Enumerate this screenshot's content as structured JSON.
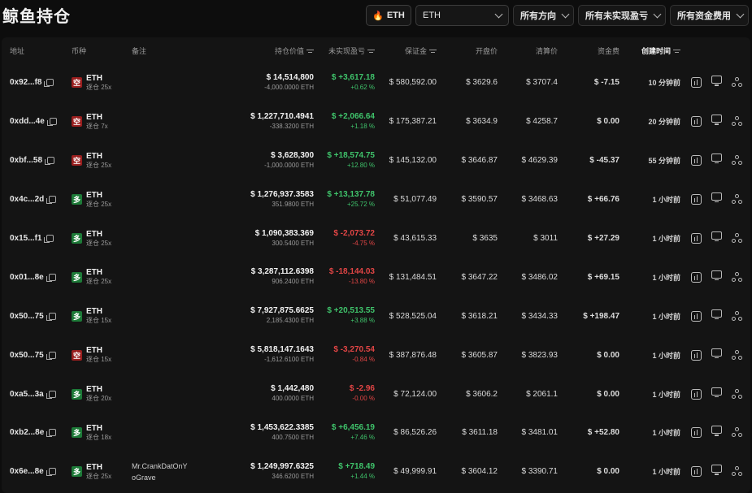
{
  "title": "鲸鱼持仓",
  "filters": {
    "coin_tag": "ETH",
    "coin_select": "ETH",
    "direction": "所有方向",
    "unrealized": "所有未实现盈亏",
    "funding": "所有资金费用"
  },
  "columns": {
    "address": "地址",
    "coin": "币种",
    "note": "备注",
    "value": "持仓价值",
    "pnl": "未实现盈亏",
    "margin": "保证金",
    "open_price": "开盘价",
    "liq_price": "清算价",
    "funding": "资金费",
    "created": "创建时间"
  },
  "rows": [
    {
      "address": "0x92...f8",
      "side": "空",
      "side_type": "short",
      "coin": "ETH",
      "leverage": "逐仓 25x",
      "note1": "",
      "note2": "",
      "value": "$ 14,514,800",
      "size": "-4,000.0000 ETH",
      "pnl": "$ +3,617.18",
      "pnl_pct": "+0.62 %",
      "pnl_type": "pos",
      "margin": "$ 580,592.00",
      "open": "$ 3629.6",
      "liq": "$ 3707.4",
      "funding": "$ -7.15",
      "funding_type": "neg",
      "time": "10 分钟前"
    },
    {
      "address": "0xdd...4e",
      "side": "空",
      "side_type": "short",
      "coin": "ETH",
      "leverage": "逐仓 7x",
      "note1": "",
      "note2": "",
      "value": "$ 1,227,710.4941",
      "size": "-338.3200 ETH",
      "pnl": "$ +2,066.64",
      "pnl_pct": "+1.18 %",
      "pnl_type": "pos",
      "margin": "$ 175,387.21",
      "open": "$ 3634.9",
      "liq": "$ 4258.7",
      "funding": "$ 0.00",
      "funding_type": "plain",
      "time": "20 分钟前"
    },
    {
      "address": "0xbf...58",
      "side": "空",
      "side_type": "short",
      "coin": "ETH",
      "leverage": "逐仓 25x",
      "note1": "",
      "note2": "",
      "value": "$ 3,628,300",
      "size": "-1,000.0000 ETH",
      "pnl": "$ +18,574.75",
      "pnl_pct": "+12.80 %",
      "pnl_type": "pos",
      "margin": "$ 145,132.00",
      "open": "$ 3646.87",
      "liq": "$ 4629.39",
      "funding": "$ -45.37",
      "funding_type": "neg",
      "time": "55 分钟前"
    },
    {
      "address": "0x4c...2d",
      "side": "多",
      "side_type": "long",
      "coin": "ETH",
      "leverage": "逐仓 25x",
      "note1": "",
      "note2": "",
      "value": "$ 1,276,937.3583",
      "size": "351.9800 ETH",
      "pnl": "$ +13,137.78",
      "pnl_pct": "+25.72 %",
      "pnl_type": "pos",
      "margin": "$ 51,077.49",
      "open": "$ 3590.57",
      "liq": "$ 3468.63",
      "funding": "$ +66.76",
      "funding_type": "pos",
      "time": "1 小时前"
    },
    {
      "address": "0x15...f1",
      "side": "多",
      "side_type": "long",
      "coin": "ETH",
      "leverage": "逐仓 25x",
      "note1": "",
      "note2": "",
      "value": "$ 1,090,383.369",
      "size": "300.5400 ETH",
      "pnl": "$ -2,073.72",
      "pnl_pct": "-4.75 %",
      "pnl_type": "neg",
      "margin": "$ 43,615.33",
      "open": "$ 3635",
      "liq": "$ 3011",
      "funding": "$ +27.29",
      "funding_type": "pos",
      "time": "1 小时前"
    },
    {
      "address": "0x01...8e",
      "side": "多",
      "side_type": "long",
      "coin": "ETH",
      "leverage": "逐仓 25x",
      "note1": "",
      "note2": "",
      "value": "$ 3,287,112.6398",
      "size": "906.2400 ETH",
      "pnl": "$ -18,144.03",
      "pnl_pct": "-13.80 %",
      "pnl_type": "neg",
      "margin": "$ 131,484.51",
      "open": "$ 3647.22",
      "liq": "$ 3486.02",
      "funding": "$ +69.15",
      "funding_type": "pos",
      "time": "1 小时前"
    },
    {
      "address": "0x50...75",
      "side": "多",
      "side_type": "long",
      "coin": "ETH",
      "leverage": "逐仓 15x",
      "note1": "",
      "note2": "",
      "value": "$ 7,927,875.6625",
      "size": "2,185.4300 ETH",
      "pnl": "$ +20,513.55",
      "pnl_pct": "+3.88 %",
      "pnl_type": "pos",
      "margin": "$ 528,525.04",
      "open": "$ 3618.21",
      "liq": "$ 3434.33",
      "funding": "$ +198.47",
      "funding_type": "pos",
      "time": "1 小时前"
    },
    {
      "address": "0x50...75",
      "side": "空",
      "side_type": "short",
      "coin": "ETH",
      "leverage": "逐仓 15x",
      "note1": "",
      "note2": "",
      "value": "$ 5,818,147.1643",
      "size": "-1,612.6100 ETH",
      "pnl": "$ -3,270.54",
      "pnl_pct": "-0.84 %",
      "pnl_type": "neg",
      "margin": "$ 387,876.48",
      "open": "$ 3605.87",
      "liq": "$ 3823.93",
      "funding": "$ 0.00",
      "funding_type": "plain",
      "time": "1 小时前"
    },
    {
      "address": "0xa5...3a",
      "side": "多",
      "side_type": "long",
      "coin": "ETH",
      "leverage": "逐仓 20x",
      "note1": "",
      "note2": "",
      "value": "$ 1,442,480",
      "size": "400.0000 ETH",
      "pnl": "$ -2.96",
      "pnl_pct": "-0.00 %",
      "pnl_type": "neg",
      "margin": "$ 72,124.00",
      "open": "$ 3606.2",
      "liq": "$ 2061.1",
      "funding": "$ 0.00",
      "funding_type": "plain",
      "time": "1 小时前"
    },
    {
      "address": "0xb2...8e",
      "side": "多",
      "side_type": "long",
      "coin": "ETH",
      "leverage": "逐仓 18x",
      "note1": "",
      "note2": "",
      "value": "$ 1,453,622.3385",
      "size": "400.7500 ETH",
      "pnl": "$ +6,456.19",
      "pnl_pct": "+7.46 %",
      "pnl_type": "pos",
      "margin": "$ 86,526.26",
      "open": "$ 3611.18",
      "liq": "$ 3481.01",
      "funding": "$ +52.80",
      "funding_type": "pos",
      "time": "1 小时前"
    },
    {
      "address": "0x6e...8e",
      "side": "多",
      "side_type": "long",
      "coin": "ETH",
      "leverage": "逐仓 25x",
      "note1": "Mr.CrankDatOnY",
      "note2": "oGrave",
      "value": "$ 1,249,997.6325",
      "size": "346.6200 ETH",
      "pnl": "$ +718.49",
      "pnl_pct": "+1.44 %",
      "pnl_type": "pos",
      "margin": "$ 49,999.91",
      "open": "$ 3604.12",
      "liq": "$ 3390.71",
      "funding": "$ 0.00",
      "funding_type": "plain",
      "time": "1 小时前"
    }
  ],
  "colors": {
    "positive": "#3fc36b",
    "negative": "#e24545",
    "short_badge": "#9a1f1f",
    "long_badge": "#1d7a38"
  },
  "row_icons": [
    "chart-icon",
    "monitor-icon",
    "share-icon"
  ]
}
